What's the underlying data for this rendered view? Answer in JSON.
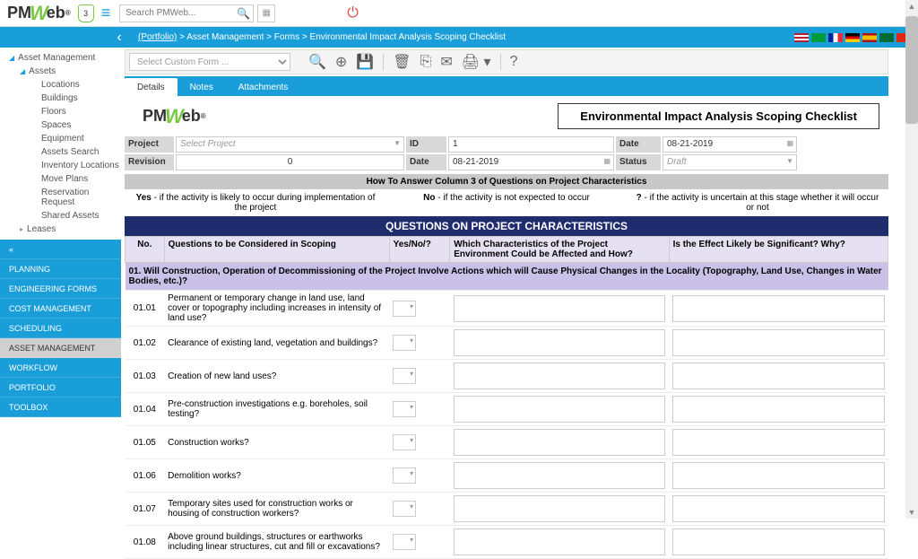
{
  "app": {
    "name": "PMWeb",
    "shield_badge": "3"
  },
  "search": {
    "placeholder": "Search PMWeb..."
  },
  "breadcrumb": {
    "portfolio": "(Portfolio)",
    "path": [
      "Asset Management",
      "Forms",
      "Environmental Impact Analysis Scoping Checklist"
    ]
  },
  "tree": {
    "root": "Asset Management",
    "assets": "Assets",
    "children": [
      "Locations",
      "Buildings",
      "Floors",
      "Spaces",
      "Equipment",
      "Assets Search",
      "Inventory Locations",
      "Move Plans",
      "Reservation Request",
      "Shared Assets"
    ],
    "leases": "Leases"
  },
  "nav": {
    "collapse": "«",
    "items": [
      "PLANNING",
      "ENGINEERING FORMS",
      "COST MANAGEMENT",
      "SCHEDULING",
      "ASSET MANAGEMENT",
      "WORKFLOW",
      "PORTFOLIO",
      "TOOLBOX"
    ],
    "active": "ASSET MANAGEMENT"
  },
  "toolbar": {
    "custom_form_placeholder": "Select Custom Form ..."
  },
  "tabs": {
    "items": [
      "Details",
      "Notes",
      "Attachments"
    ],
    "active": "Details"
  },
  "form": {
    "title": "Environmental Impact Analysis Scoping Checklist",
    "fields": {
      "project_label": "Project",
      "project_value": "Select Project",
      "revision_label": "Revision",
      "revision_value": "0",
      "id_label": "ID",
      "id_value": "1",
      "date_label2": "Date",
      "date_value2": "08-21-2019",
      "date_label": "Date",
      "date_value": "08-21-2019",
      "status_label": "Status",
      "status_value": "Draft"
    }
  },
  "howto": {
    "header": "How To Answer Column 3 of Questions on Project Characteristics",
    "yes": "Yes - if the activity is likely to occur during implementation of the project",
    "no": "No - if the activity is not expected to occur",
    "maybe": "? - if the activity is uncertain at this stage whether it will occur or not"
  },
  "qtable": {
    "banner": "QUESTIONS ON PROJECT CHARACTERISTICS",
    "headers": {
      "no": "No.",
      "question": "Questions to be Considered in Scoping",
      "yesno": "Yes/No/?",
      "char": "Which Characteristics of the Project Environment Could be Affected and How?",
      "effect": "Is the Effect Likely be Significant? Why?"
    },
    "section1": "01. Will Construction, Operation of Decommissioning of the Project Involve Actions which will Cause Physical Changes in the Locality (Topography, Land Use, Changes in Water Bodies, etc.)?",
    "rows": [
      {
        "no": "01.01",
        "q": "Permanent or temporary change in land use, land cover or topography including increases in intensity of land use?"
      },
      {
        "no": "01.02",
        "q": "Clearance of existing land, vegetation and buildings?"
      },
      {
        "no": "01.03",
        "q": "Creation of new land uses?"
      },
      {
        "no": "01.04",
        "q": "Pre-construction investigations e.g. boreholes, soil testing?"
      },
      {
        "no": "01.05",
        "q": "Construction works?"
      },
      {
        "no": "01.06",
        "q": "Demolition works?"
      },
      {
        "no": "01.07",
        "q": "Temporary sites used for construction works or housing of construction workers?"
      },
      {
        "no": "01.08",
        "q": "Above ground buildings, structures or earthworks including linear structures, cut and fill or excavations?"
      }
    ]
  }
}
